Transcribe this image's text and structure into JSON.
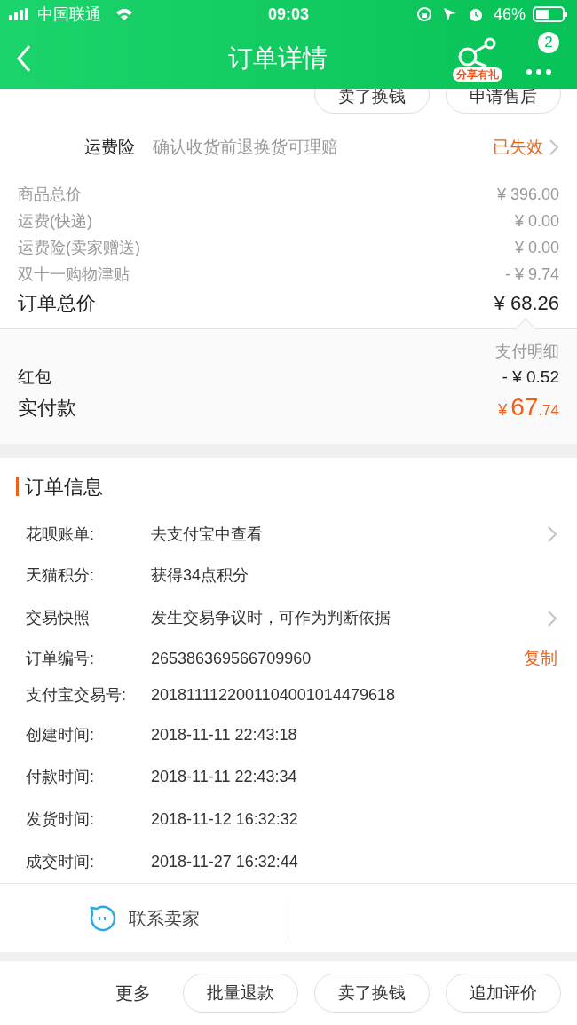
{
  "status_bar": {
    "carrier": "中国联通",
    "time": "09:03",
    "battery": "46%"
  },
  "nav": {
    "title": "订单详情",
    "share_badge": "分享有礼",
    "message_count": "2"
  },
  "top_buttons": [
    "卖了换钱",
    "申请售后"
  ],
  "insurance": {
    "label": "运费险",
    "description": "确认收货前退换货可理赔",
    "status": "已失效"
  },
  "price_rows": [
    {
      "label": "商品总价",
      "value": "¥ 396.00"
    },
    {
      "label": "运费(快递)",
      "value": "¥ 0.00"
    },
    {
      "label": "运费险(卖家赠送)",
      "value": "¥ 0.00"
    },
    {
      "label": "双十一购物津贴",
      "value": "- ¥ 9.74"
    }
  ],
  "order_total": {
    "label": "订单总价",
    "value": "¥ 68.26"
  },
  "payment": {
    "detail_link": "支付明细",
    "rows": [
      {
        "label": "红包",
        "value": "- ¥ 0.52"
      }
    ],
    "paid": {
      "label": "实付款",
      "currency": "¥",
      "integer": "67",
      "fraction": ".74"
    }
  },
  "order_info": {
    "title": "订单信息",
    "rows": [
      {
        "label": "花呗账单:",
        "value": "去支付宝中查看",
        "arrow": true
      },
      {
        "label": "天猫积分:",
        "value": "获得34点积分",
        "arrow": false
      },
      {
        "label": "交易快照",
        "value": "发生交易争议时，可作为判断依据",
        "arrow": true
      },
      {
        "label": "订单编号:",
        "value": "265386369566709960",
        "arrow": false,
        "action": "复制"
      },
      {
        "label": "支付宝交易号:",
        "value": "2018111122001104001014479618",
        "arrow": false
      },
      {
        "label": "创建时间:",
        "value": "2018-11-11 22:43:18",
        "arrow": false
      },
      {
        "label": "付款时间:",
        "value": "2018-11-11 22:43:34",
        "arrow": false
      },
      {
        "label": "发货时间:",
        "value": "2018-11-12 16:32:32",
        "arrow": false
      },
      {
        "label": "成交时间:",
        "value": "2018-11-27 16:32:44",
        "arrow": false
      }
    ]
  },
  "contact": {
    "label": "联系卖家"
  },
  "bottom_bar": {
    "more": "更多",
    "buttons": [
      "批量退款",
      "卖了换钱",
      "追加评价"
    ]
  }
}
